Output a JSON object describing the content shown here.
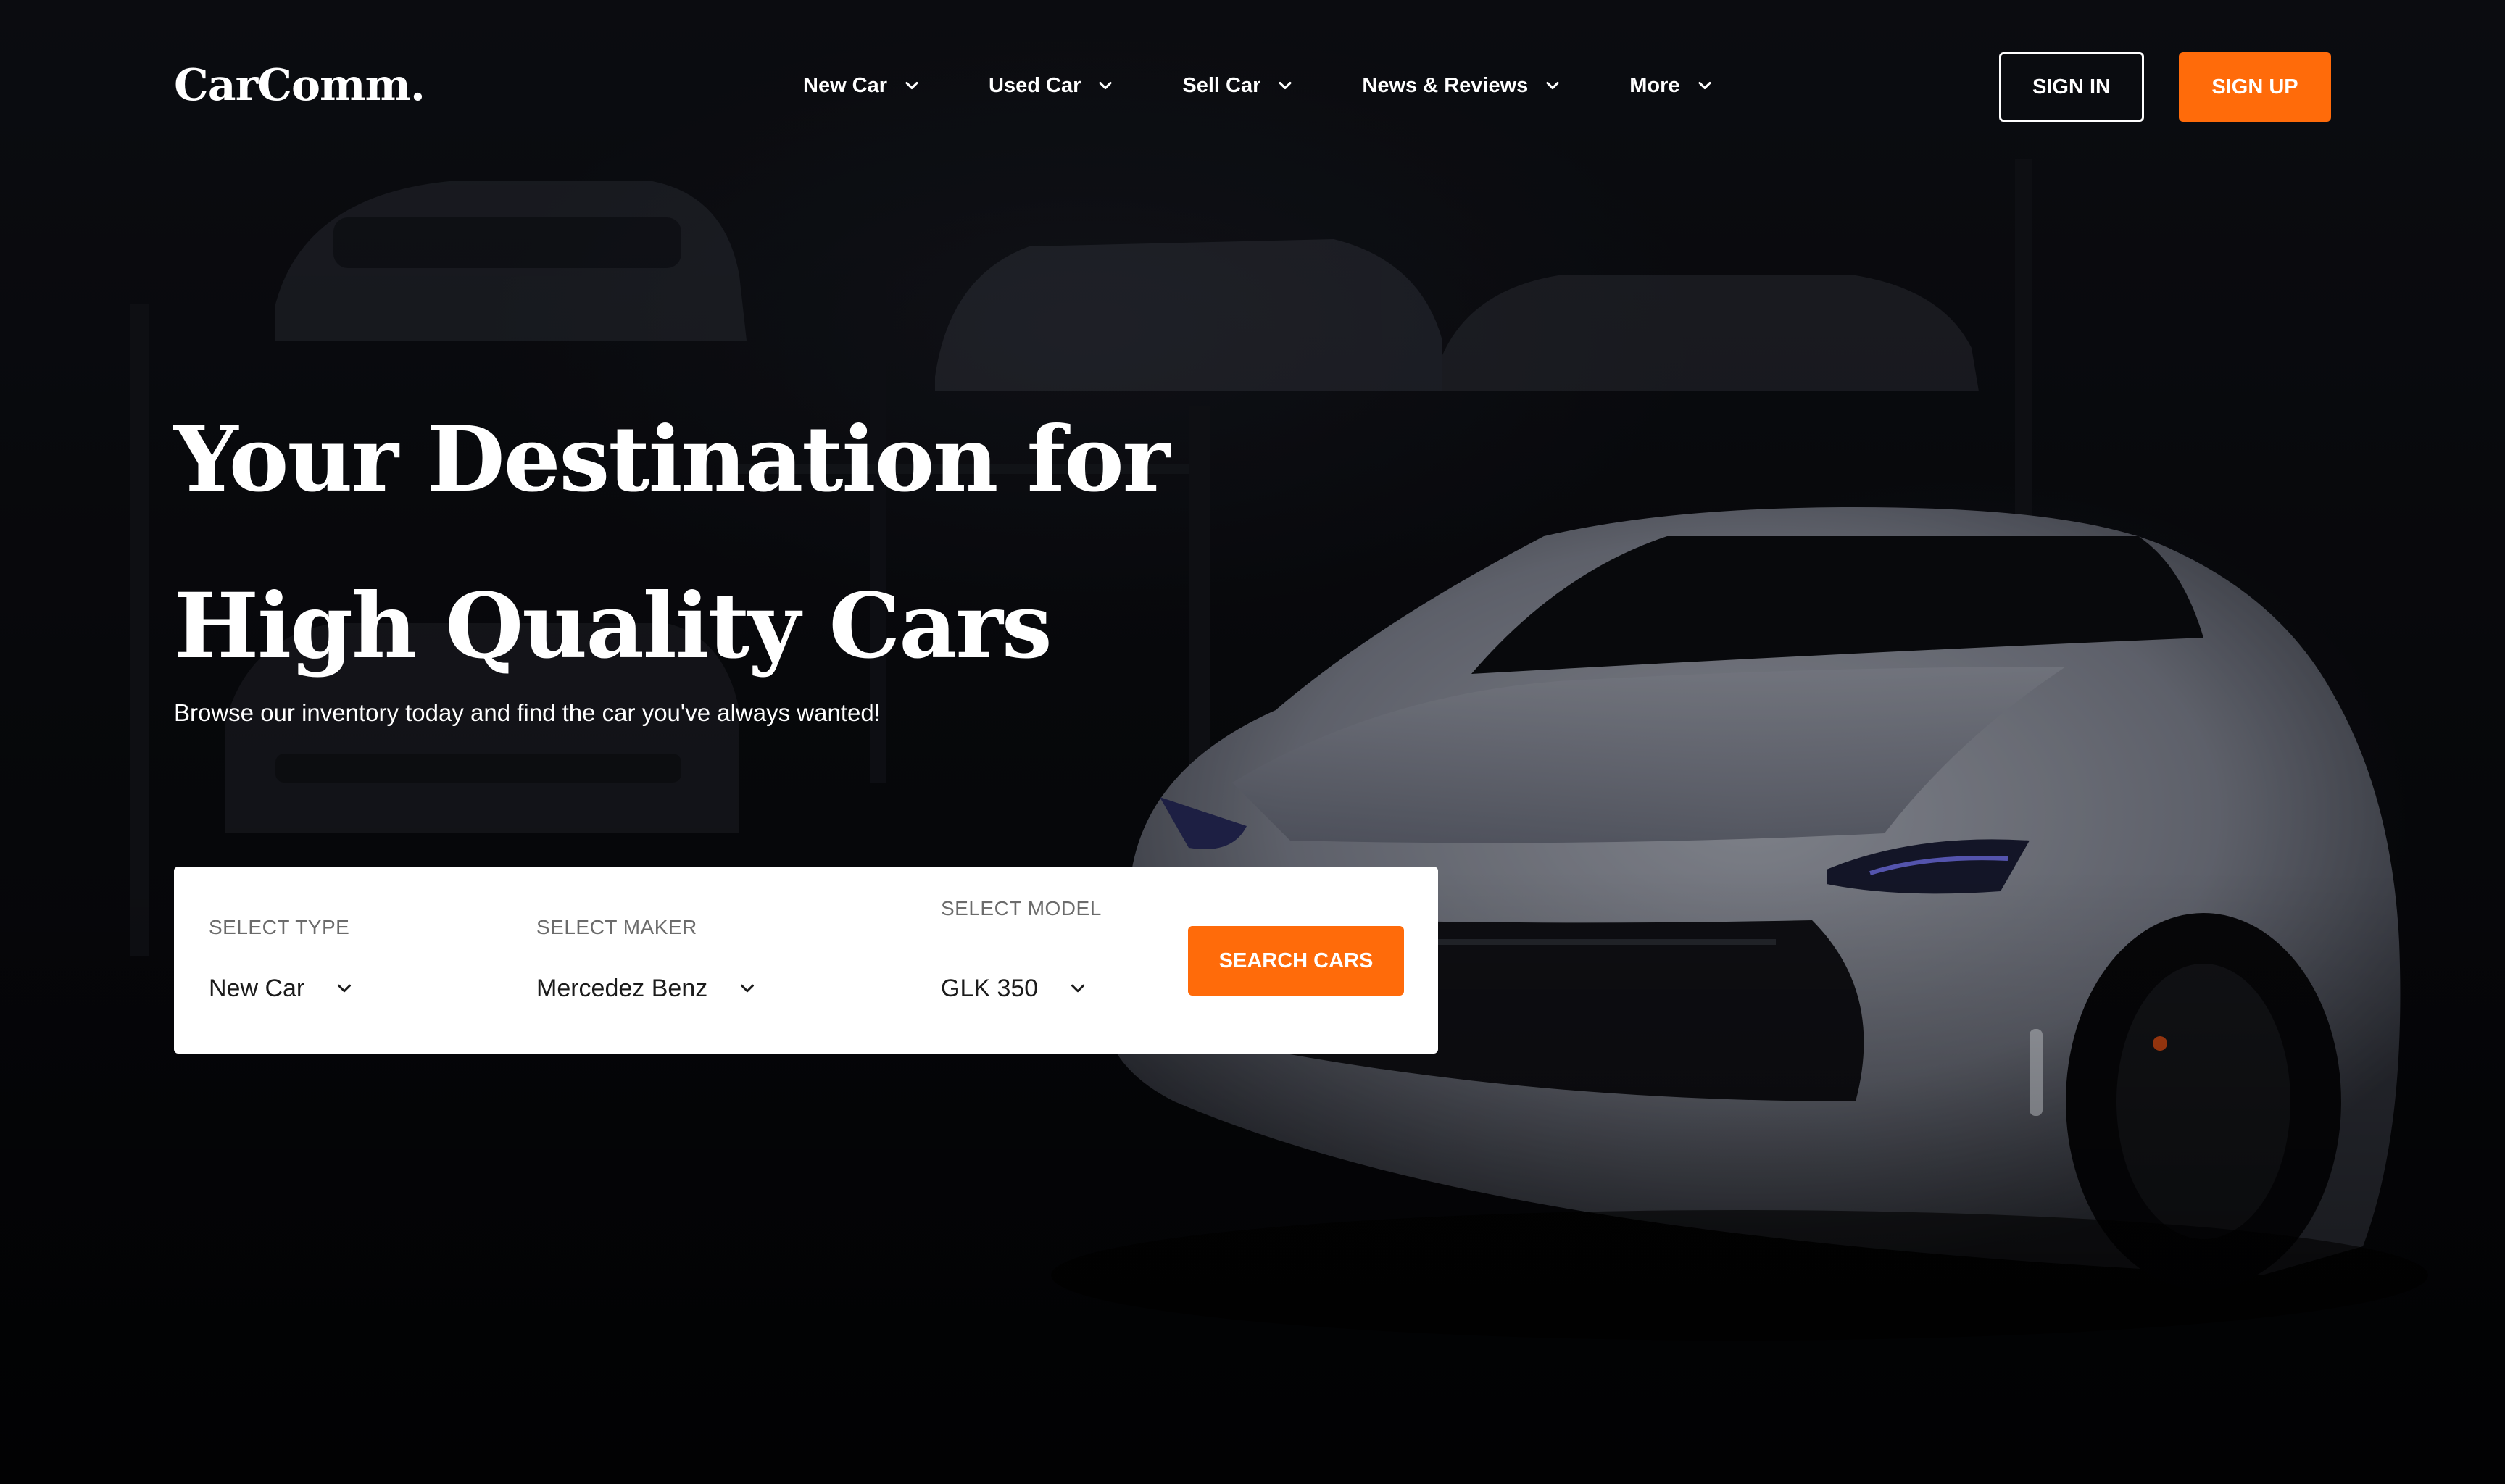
{
  "colors": {
    "accent": "#ff6b0a",
    "background": "#0b0c11",
    "card": "#ffffff",
    "text_on_dark": "#ffffff",
    "field_label": "#6b6b6b"
  },
  "header": {
    "logo": "CarComm.",
    "nav": [
      {
        "label": "New Car",
        "icon": "chevron-down-icon"
      },
      {
        "label": "Used Car",
        "icon": "chevron-down-icon"
      },
      {
        "label": "Sell Car",
        "icon": "chevron-down-icon"
      },
      {
        "label": "News & Reviews",
        "icon": "chevron-down-icon"
      },
      {
        "label": "More",
        "icon": "chevron-down-icon"
      }
    ],
    "sign_in_label": "SIGN IN",
    "sign_up_label": "SIGN UP"
  },
  "hero": {
    "title_line1": "Your Destination for",
    "title_line2": "High Quality Cars",
    "subtitle": "Browse our inventory today and find the car you've always wanted!",
    "background_image": "dark showroom with white sports car"
  },
  "search": {
    "type": {
      "label": "SELECT TYPE",
      "value": "New Car",
      "icon": "chevron-down-icon"
    },
    "maker": {
      "label": "SELECT MAKER",
      "value": "Mercedez Benz",
      "icon": "chevron-down-icon"
    },
    "model": {
      "label": "SELECT MODEL",
      "value": "GLK 350",
      "icon": "chevron-down-icon"
    },
    "button_label": "SEARCH CARS"
  }
}
